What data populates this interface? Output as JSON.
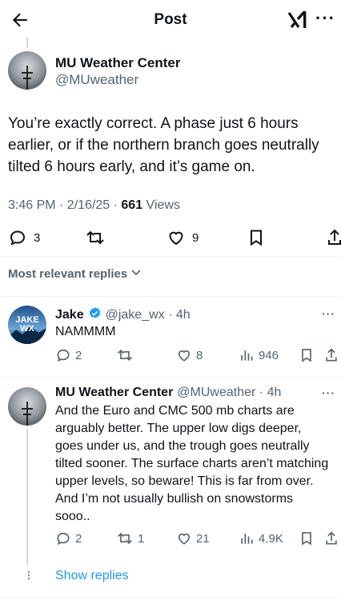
{
  "header": {
    "title": "Post"
  },
  "post": {
    "author_name": "MU Weather Center",
    "author_handle": "@MUweather",
    "text": "You’re exactly correct. A phase just 6 hours earlier, or if the northern branch goes neutrally tilted 6 hours early, and it’s game on.",
    "time": "3:46 PM · 2/16/25 · ",
    "views_count": "661",
    "views_label": " Views",
    "replies": "3",
    "likes": "9"
  },
  "replies_filter": {
    "label": "Most relevant replies"
  },
  "replies": [
    {
      "name": "Jake",
      "handle": "@jake_wx · 4h",
      "text": "NAMMMM",
      "avatar_text": "JAKE WX",
      "replies": "2",
      "reposts": "",
      "likes": "8",
      "views": "946"
    },
    {
      "name": "MU Weather Center",
      "handle": "@MUweather · 4h",
      "text": "And the Euro and CMC 500 mb charts are arguably better. The upper low digs deeper, goes under us, and the trough goes neutrally tilted sooner. The surface charts aren’t matching upper levels, so beware! This is far from over. And I’m not usually bullish on snowstorms sooo..",
      "replies": "2",
      "reposts": "1",
      "likes": "21",
      "views": "4.9K"
    }
  ],
  "show_replies": "Show replies",
  "colors": {
    "accent": "#1d9bf0",
    "muted": "#536471",
    "verified": "#1d9bf0"
  }
}
